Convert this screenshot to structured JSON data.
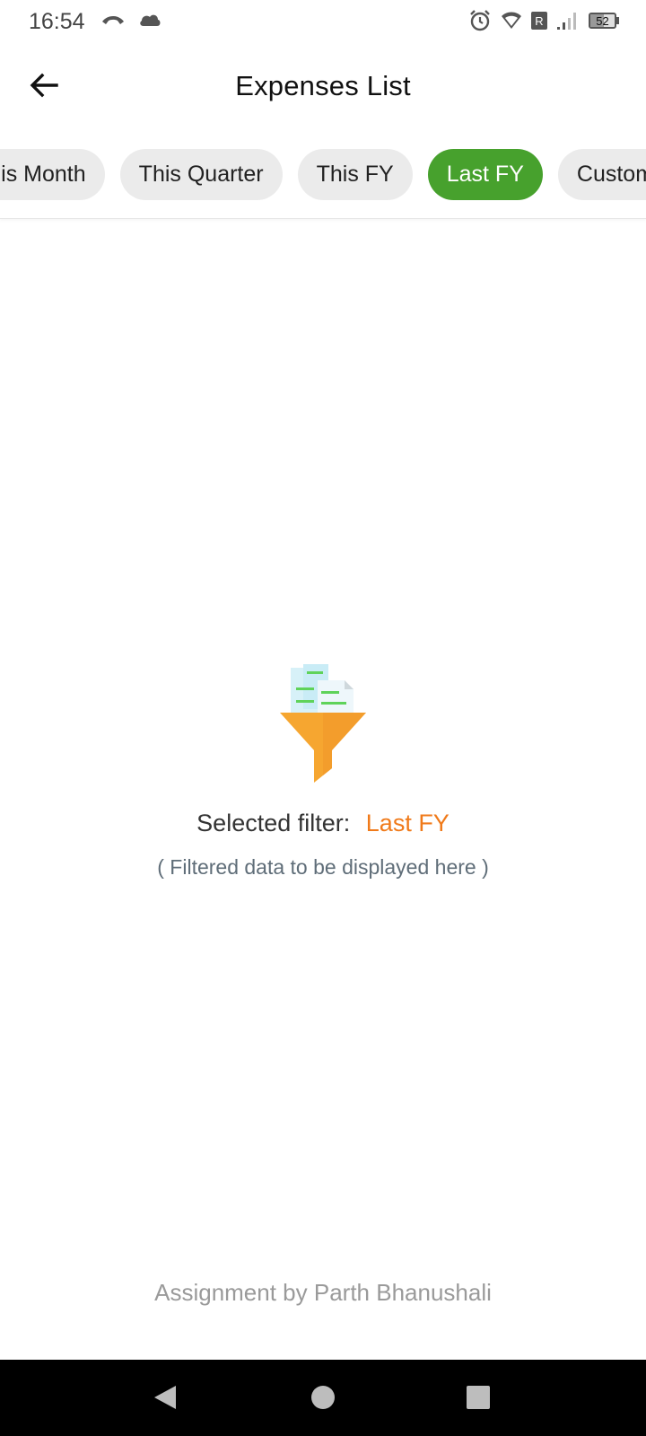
{
  "status_bar": {
    "time": "16:54",
    "battery": "52",
    "icons": [
      "phone-missed-icon",
      "cloud-icon",
      "alarm-icon",
      "wifi-icon",
      "roaming-icon",
      "signal-icon",
      "battery-icon"
    ]
  },
  "app_bar": {
    "title": "Expenses List",
    "back_icon": "arrow-left-icon"
  },
  "filters": {
    "chips": [
      {
        "label": "This Month",
        "active": false
      },
      {
        "label": "This Quarter",
        "active": false
      },
      {
        "label": "This FY",
        "active": false
      },
      {
        "label": "Last FY",
        "active": true
      },
      {
        "label": "Custom",
        "active": false
      }
    ],
    "accent_color": "#47a12d"
  },
  "empty_state": {
    "icon": "funnel-filter-icon",
    "label": "Selected filter:",
    "value": "Last FY",
    "value_color": "#f07a1a",
    "subtitle": "( Filtered data to be displayed here )"
  },
  "footer": {
    "text": "Assignment by Parth Bhanushali"
  },
  "nav_bar": {
    "icons": [
      "back-triangle-icon",
      "home-circle-icon",
      "recents-square-icon"
    ]
  }
}
